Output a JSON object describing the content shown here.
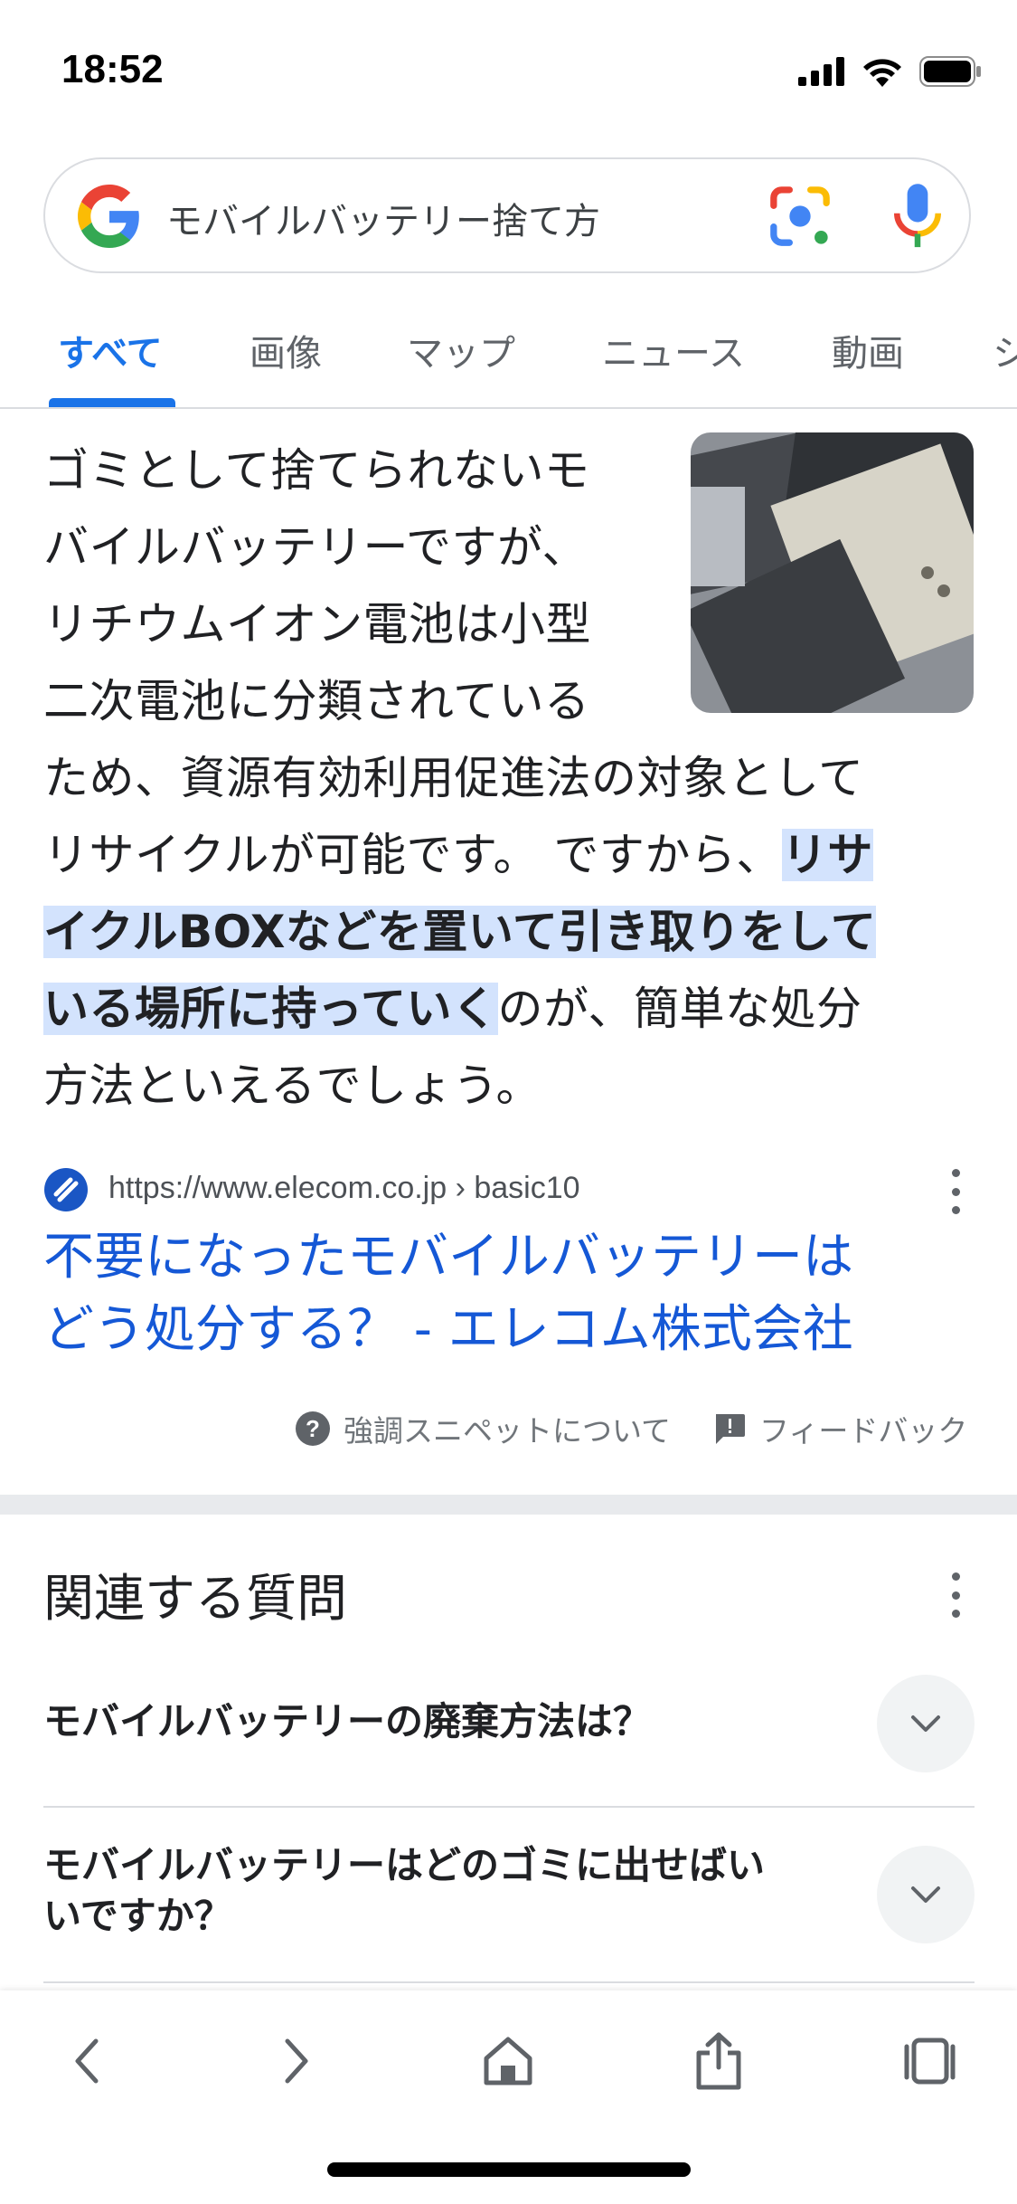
{
  "status_bar": {
    "time": "18:52"
  },
  "search": {
    "query": "モバイルバッテリー捨て方"
  },
  "tabs": [
    {
      "label": "すべて",
      "active": true
    },
    {
      "label": "画像"
    },
    {
      "label": "マップ"
    },
    {
      "label": "ニュース"
    },
    {
      "label": "動画"
    },
    {
      "label": "シ"
    }
  ],
  "snippet": {
    "lines": [
      "ゴミとして捨てられないモ",
      "バイルバッテリーですが、",
      "リチウムイオン電池は小型",
      "二次電池に分類されている",
      "ため、資源有効利用促進法の対象として"
    ],
    "line6_normal": "リサイクルが可能です。 ですから、",
    "line6_highlight": "リサ",
    "line7_highlight": "イクルBOXなどを置いて引き取りをして",
    "line8_highlight": "いる場所に持っていく",
    "line8_normal": "のが、簡単な処分",
    "line9_normal": "方法といえるでしょう。"
  },
  "source": {
    "url": "https://www.elecom.co.jp › basic10",
    "title_lines": [
      "不要になったモバイルバッテリーは",
      "どう処分する？ - エレコム株式会社"
    ]
  },
  "feedback": {
    "about_label": "強調スニペットについて",
    "feedback_label": "フィードバック"
  },
  "paa": {
    "title": "関連する質問",
    "questions": [
      {
        "lines": [
          "モバイルバッテリーの廃棄方法は？"
        ]
      },
      {
        "lines": [
          "モバイルバッテリーはどのゴミに出せばい",
          "いですか？"
        ]
      }
    ]
  },
  "colors": {
    "accent": "#1a73e8",
    "link": "#1558d6",
    "highlight": "#d3e3fd"
  }
}
